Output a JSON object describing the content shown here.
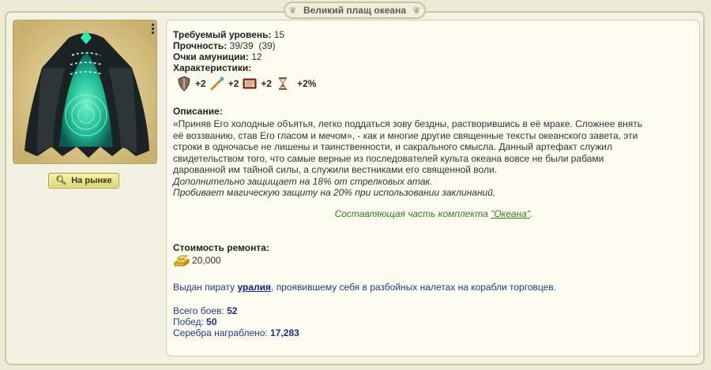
{
  "title": "Великий плащ океана",
  "market_button": "На рынке",
  "stats": {
    "level": {
      "label": "Требуемый уровень:",
      "value": "15"
    },
    "durability": {
      "label": "Прочность:",
      "value": "39/39  (39)"
    },
    "ammo": {
      "label": "Очки амуниции:",
      "value": "12"
    },
    "characteristics_label": "Характеристики:",
    "bonuses": [
      {
        "icon": "shield-icon",
        "value": "+2"
      },
      {
        "icon": "spyglass-icon",
        "value": "+2"
      },
      {
        "icon": "book-icon",
        "value": "+2"
      },
      {
        "icon": "hourglass-icon",
        "value": "+2%"
      }
    ]
  },
  "description": {
    "label": "Описание:",
    "lines": [
      "«Приняв Его холодные объятья, легко поддаться зову бездны, растворившись в её мраке. Сложнее внять",
      "её воззванию, став Его гласом и мечом», - как и многие другие священные тексты океанского завета, эти",
      "строки в одночасье не лишены и таинственности, и сакрального смысла. Данный артефакт служил",
      "свидетельством того, что самые верные из последователей культа океана вовсе не были рабами",
      "дарованной им тайной силы, а служили вестниками его священной воли."
    ],
    "effects": [
      "Дополнительно защищает на 18% от стрелковых атак.",
      "Пробивает магическую защиту на 20% при использовании заклинаний."
    ],
    "set_prefix": "Составляющая часть комплекта ",
    "set_name": "\"Океана\"",
    "set_suffix": "."
  },
  "repair": {
    "label": "Стоимость ремонта:",
    "cost": "20,000"
  },
  "owner": {
    "prefix": "Выдан пирату ",
    "name": "уралия",
    "suffix": ", проявившему себя в разбойных налетах на корабли торговцев."
  },
  "battles": {
    "total_label": "Всего боев:",
    "total": "52",
    "wins_label": "Побед:",
    "wins": "50",
    "silver_label": "Серебра награблено:",
    "silver": "17,283"
  }
}
